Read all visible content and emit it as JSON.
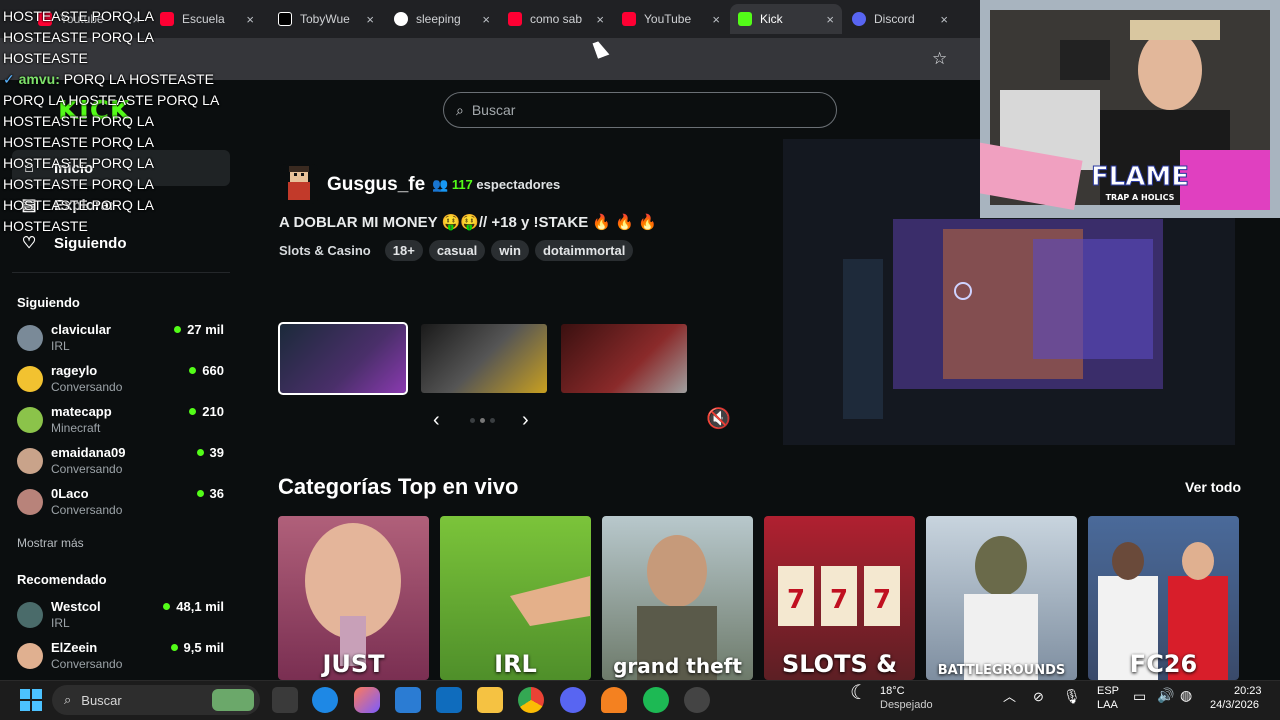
{
  "browser": {
    "tabs": [
      {
        "label": "Youtube",
        "color": "#ff0033"
      },
      {
        "label": "Escuela",
        "color": "#ff0033"
      },
      {
        "label": "TobyWue",
        "color": "#ffffff"
      },
      {
        "label": "sleeping",
        "color": "#4285f4"
      },
      {
        "label": "como sab",
        "color": "#ff0033"
      },
      {
        "label": "YouTube",
        "color": "#ff0033"
      },
      {
        "label": "Kick",
        "color": "#53fc18"
      },
      {
        "label": "Discord",
        "color": "#5865f2"
      }
    ],
    "tab_close_glyph": "×",
    "star_icon": "☆"
  },
  "chat_overlay": {
    "line1": "HOSTEASTE PORQ LA HOSTEASTE PORQ LA HOSTEASTE",
    "user": "amvu",
    "message": "PORQ LA HOSTEASTE PORQ LA HOSTEASTE PORQ LA HOSTEASTE PORQ LA HOSTEASTE PORQ LA HOSTEASTE PORQ LA HOSTEASTE PORQ LA HOSTEASTE PORQ LA HOSTEASTE"
  },
  "brand": {
    "logo": "KICK",
    "accent": "#53fc18"
  },
  "nav": {
    "items": [
      {
        "label": "Inicio",
        "icon": "home-icon"
      },
      {
        "label": "Explorar",
        "icon": "compass-icon"
      },
      {
        "label": "Siguiendo",
        "icon": "heart-icon"
      }
    ]
  },
  "following": {
    "title": "Siguiendo",
    "channels": [
      {
        "name": "clavicular",
        "category": "IRL",
        "viewers": "27 mil",
        "color": "#7a8a98"
      },
      {
        "name": "rageylo",
        "category": "Conversando",
        "viewers": "660",
        "color": "#f2c230"
      },
      {
        "name": "matecapp",
        "category": "Minecraft",
        "viewers": "210",
        "color": "#8bc34a"
      },
      {
        "name": "emaidana09",
        "category": "Conversando",
        "viewers": "39",
        "color": "#c9a38a"
      },
      {
        "name": "0Laco",
        "category": "Conversando",
        "viewers": "36",
        "color": "#b8837a"
      }
    ],
    "more_label": "Mostrar más"
  },
  "recommended": {
    "title": "Recomendado",
    "channels": [
      {
        "name": "Westcol",
        "category": "IRL",
        "viewers": "48,1 mil",
        "color": "#4a6b6a"
      },
      {
        "name": "ElZeein",
        "category": "Conversando",
        "viewers": "9,5 mil",
        "color": "#e0b090"
      }
    ]
  },
  "search": {
    "placeholder": "Buscar"
  },
  "featured": {
    "streamer": "Gusgus_fe",
    "viewers_count": "117",
    "viewers_label": "espectadores",
    "title": "A DOBLAR MI MONEY 🤑🤑// +18 y !STAKE 🔥 🔥 🔥",
    "category": "Slots & Casino",
    "tags": [
      "18+",
      "casual",
      "win",
      "dotaimmortal"
    ]
  },
  "carousel": {
    "prev": "‹",
    "next": "›",
    "mute_icon": "🔇"
  },
  "categories": {
    "title": "Categorías Top en vivo",
    "see_all": "Ver todo",
    "cards": [
      {
        "label": "JUST",
        "color": "#7a2f52"
      },
      {
        "label": "IRL",
        "color": "#4f8f2a"
      },
      {
        "label": "grand theft",
        "color": "#6d7a6a"
      },
      {
        "label": "SLOTS &",
        "color": "#5c1f24"
      },
      {
        "label": "BATTLEGROUNDS",
        "color": "#7e8ea0"
      },
      {
        "label": "FC26",
        "color": "#3a4a6a"
      }
    ]
  },
  "webcam": {
    "banner": "FLAME",
    "sub": "TRAP A HOLICS"
  },
  "taskbar": {
    "search": "Buscar",
    "weather_temp": "18°C",
    "weather_desc": "Despejado",
    "lang1": "ESP",
    "lang2": "LAA",
    "time": "20:23",
    "date": "24/3/2026"
  }
}
